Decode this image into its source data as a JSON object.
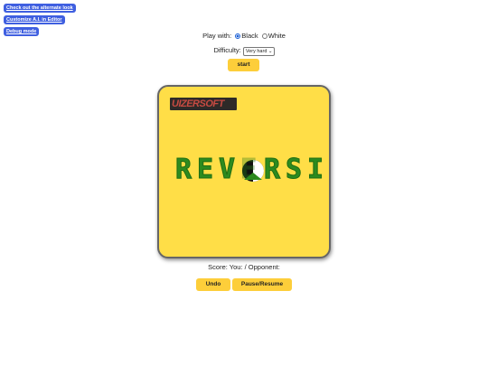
{
  "top_links": [
    "Check out the alternate look",
    "Customize A.I. in Editor",
    "Debug mode"
  ],
  "play_with": {
    "label": "Play with:",
    "options": [
      "Black",
      "White"
    ],
    "selected": "Black"
  },
  "difficulty": {
    "label": "Difficulty:",
    "selected": "Very hard"
  },
  "start_label": "start",
  "board": {
    "logo": "UIZERSOFT",
    "title_letters": [
      "R",
      "E",
      "V",
      "E",
      "R",
      "S",
      "I"
    ],
    "colors": {
      "background": "#ffde47",
      "letters": "#2d8b1f"
    }
  },
  "score": {
    "label": "Score: You: / Opponent:"
  },
  "buttons": {
    "undo": "Undo",
    "pause_resume": "Pause/Resume"
  }
}
